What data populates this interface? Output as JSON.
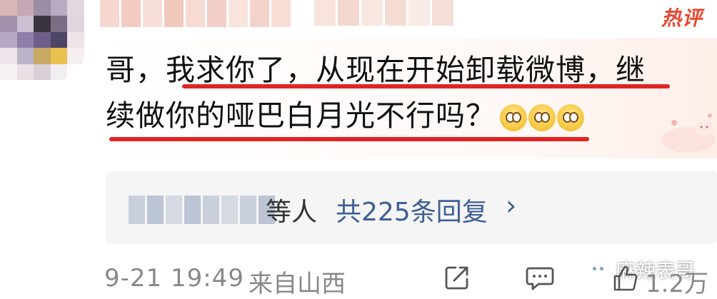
{
  "comment": {
    "badge": "热评",
    "text_line1": "哥，我求你了，从现在开始卸载微博，继",
    "text_line2": "续做你的哑巴白月光不行吗？",
    "emoji": [
      "pleading-face",
      "pleading-face",
      "pleading-face"
    ]
  },
  "replies": {
    "by_suffix": "等人",
    "count_label": "共225条回复",
    "chevron": "›"
  },
  "footer": {
    "time": "9-21 19:49",
    "location": "来自山西",
    "like_count": "1.2万",
    "icons": [
      "share-icon",
      "comment-icon",
      "like-icon"
    ]
  },
  "watermark": {
    "text": "麻辣表哥"
  },
  "colors": {
    "accent_red": "#e02424",
    "hot_tag": "#e8472f",
    "link_blue": "#3e5f94",
    "meta_gray": "#888888"
  }
}
